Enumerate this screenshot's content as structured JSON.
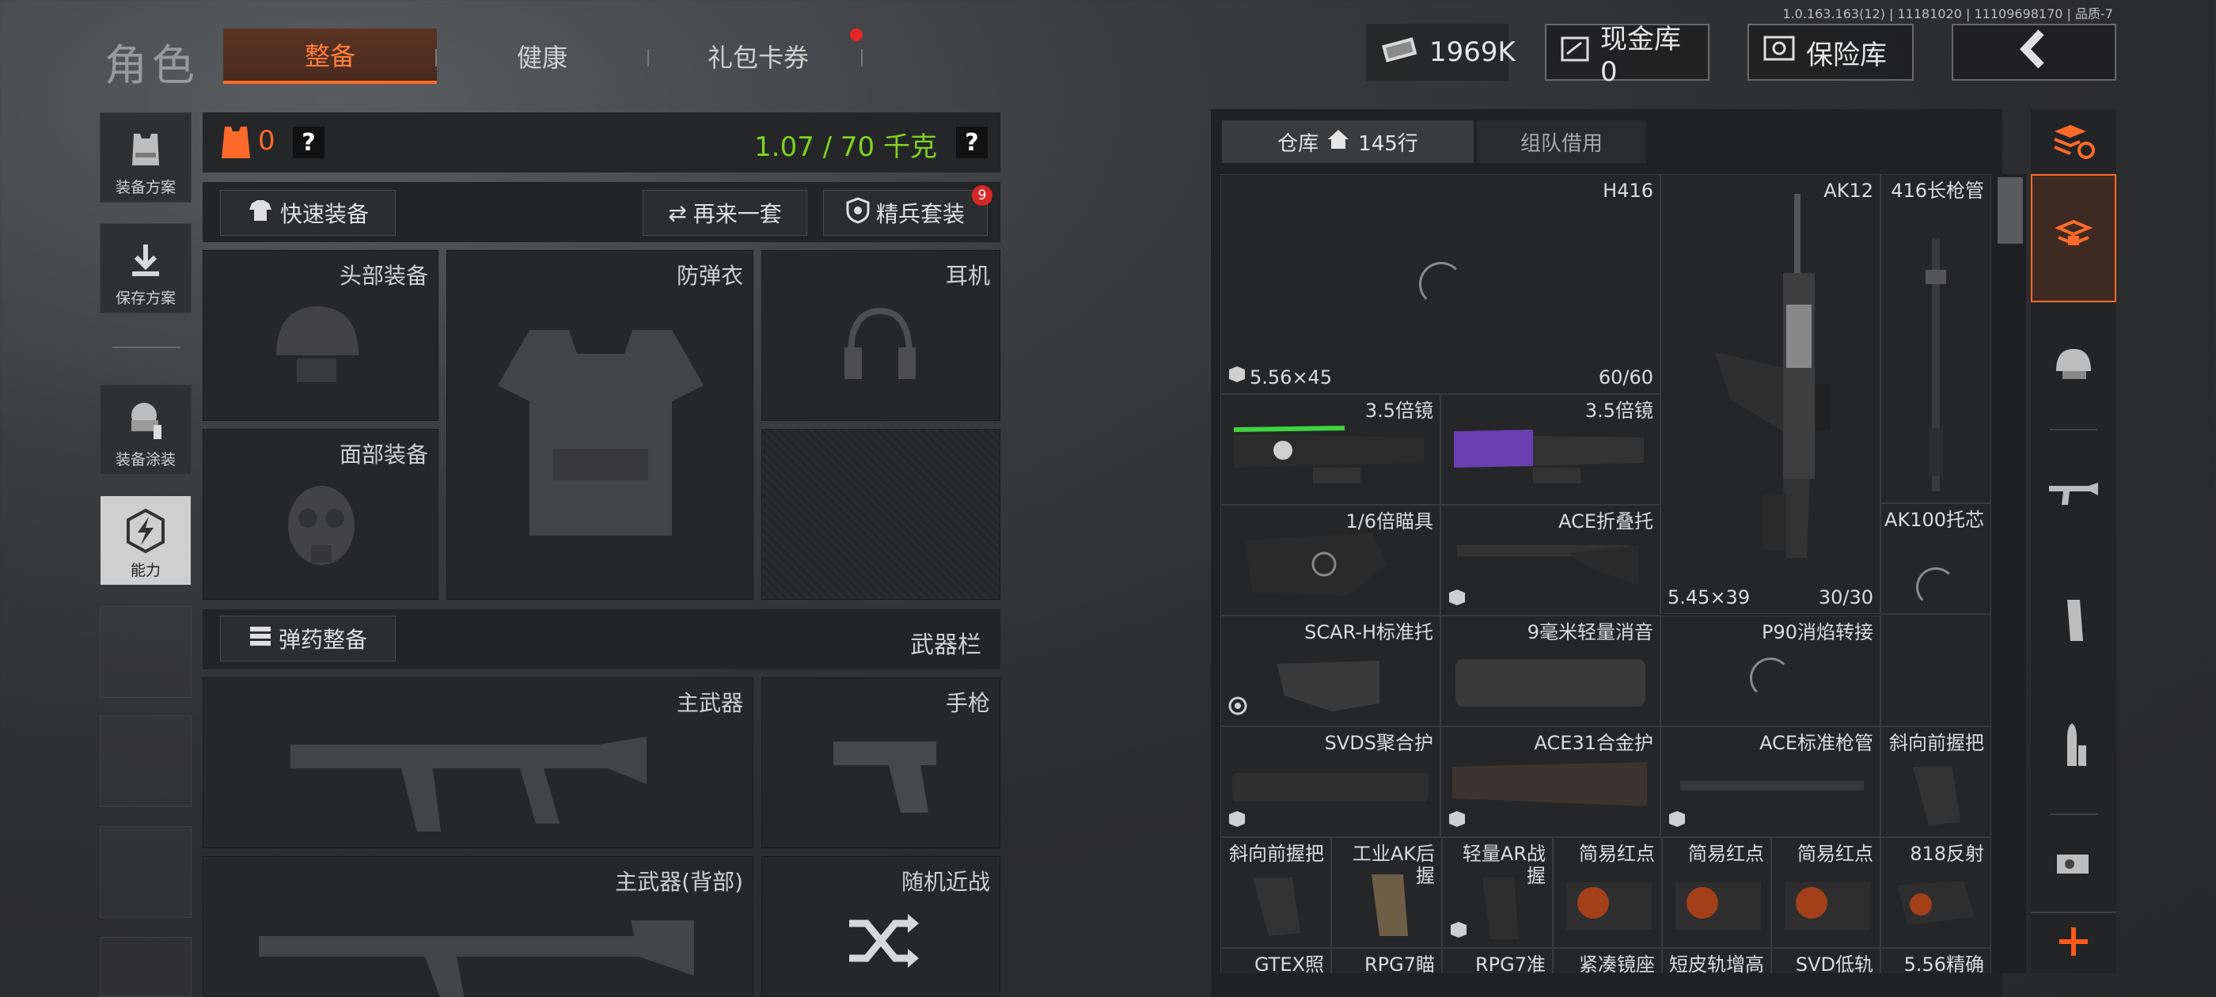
{
  "version": "1.0.163.163(12) | 11181020 | 11109698170 | 品质-7",
  "header": {
    "title": "角色",
    "tabs": [
      "整备",
      "健康",
      "礼包卡券"
    ],
    "money": "1969K",
    "cash_vault": "现金库 0",
    "safe_vault": "保险库"
  },
  "sidebar": {
    "items": [
      {
        "label": "装备方案",
        "icon": "armor-plan-icon"
      },
      {
        "label": "保存方案",
        "icon": "download-save-icon"
      },
      {
        "label": "装备涂装",
        "icon": "paint-skin-icon"
      },
      {
        "label": "能力",
        "icon": "ability-bolt-icon"
      }
    ]
  },
  "loadout": {
    "armor_count": "0",
    "weight": "1.07 / 70 千克",
    "help": "?",
    "quick_equip": "快速装备",
    "redo": "再来一套",
    "elite_set": "精兵套装",
    "elite_badge": "9",
    "slots": {
      "head": "头部装备",
      "vest": "防弹衣",
      "headset": "耳机",
      "face": "面部装备"
    },
    "ammo_equip": "弹药整备",
    "weapon_bar": "武器栏",
    "weapons": {
      "primary": "主武器",
      "pistol": "手枪",
      "primary_back": "主武器(背部)",
      "melee": "随机近战"
    }
  },
  "warehouse": {
    "tab_storage": "仓库",
    "rows": "145行",
    "tab_team": "组队借用",
    "items": [
      {
        "name": "H416",
        "ammo": "5.56×45",
        "count": "60/60"
      },
      {
        "name": "AK12",
        "ammo": "5.45×39",
        "count": "30/30"
      },
      {
        "name": "416长枪管"
      },
      {
        "name": "3.5倍镜"
      },
      {
        "name": "3.5倍镜"
      },
      {
        "name": "1/6倍瞄具"
      },
      {
        "name": "ACE折叠托"
      },
      {
        "name": "AK100托芯"
      },
      {
        "name": "SCAR-H标准托"
      },
      {
        "name": "9毫米轻量消音"
      },
      {
        "name": "P90消焰转接"
      },
      {
        "name": "SVDS聚合护"
      },
      {
        "name": "ACE31合金护"
      },
      {
        "name": "ACE标准枪管"
      },
      {
        "name": "斜向前握把"
      },
      {
        "name": "斜向前握把"
      },
      {
        "name": "工业AK后握"
      },
      {
        "name": "轻量AR战握"
      },
      {
        "name": "简易红点"
      },
      {
        "name": "简易红点"
      },
      {
        "name": "简易红点"
      },
      {
        "name": "818反射"
      },
      {
        "name": "GTEX照"
      },
      {
        "name": "RPG7瞄"
      },
      {
        "name": "RPG7准"
      },
      {
        "name": "紧凑镜座"
      },
      {
        "name": "短皮轨增高"
      },
      {
        "name": "SVD低轨"
      },
      {
        "name": "5.56精确"
      }
    ]
  },
  "colors": {
    "accent": "#ff6a2a",
    "weight_green": "#7fd320",
    "badge_red": "#d62828"
  }
}
